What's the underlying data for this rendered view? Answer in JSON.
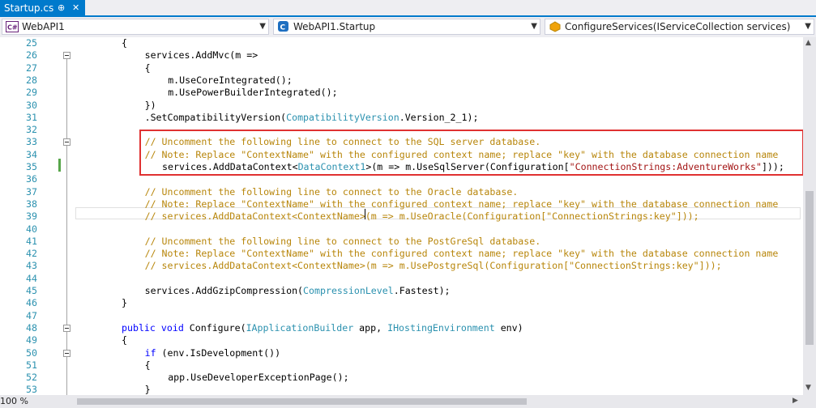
{
  "tab": {
    "title": "Startup.cs",
    "pin": "⊕",
    "close": "✕"
  },
  "nav": {
    "project": "WebAPI1",
    "type": "WebAPI1.Startup",
    "member": "ConfigureServices(IServiceCollection services)"
  },
  "editor": {
    "lines": [
      {
        "n": "25",
        "indent": 8,
        "tokens": [
          {
            "c": "p",
            "v": "{"
          }
        ]
      },
      {
        "n": "26",
        "indent": 12,
        "tokens": [
          {
            "c": "p",
            "v": "services.AddMvc(m =>"
          }
        ]
      },
      {
        "n": "27",
        "indent": 12,
        "tokens": [
          {
            "c": "p",
            "v": "{"
          }
        ]
      },
      {
        "n": "28",
        "indent": 16,
        "tokens": [
          {
            "c": "p",
            "v": "m.UseCoreIntegrated();"
          }
        ]
      },
      {
        "n": "29",
        "indent": 16,
        "tokens": [
          {
            "c": "p",
            "v": "m.UsePowerBuilderIntegrated();"
          }
        ]
      },
      {
        "n": "30",
        "indent": 12,
        "tokens": [
          {
            "c": "p",
            "v": "})"
          }
        ]
      },
      {
        "n": "31",
        "indent": 12,
        "tokens": [
          {
            "c": "p",
            "v": ".SetCompatibilityVersion("
          },
          {
            "c": "t",
            "v": "CompatibilityVersion"
          },
          {
            "c": "p",
            "v": ".Version_2_1);"
          }
        ]
      },
      {
        "n": "32",
        "indent": 0,
        "tokens": []
      },
      {
        "n": "33",
        "indent": 12,
        "tokens": [
          {
            "c": "cmt",
            "v": "// Uncomment the following line to connect to the SQL server database."
          }
        ]
      },
      {
        "n": "34",
        "indent": 12,
        "tokens": [
          {
            "c": "cmt",
            "v": "// Note: Replace \"ContextName\" with the configured context name; replace \"key\" with the database connection name"
          }
        ]
      },
      {
        "n": "35",
        "indent": 15,
        "tokens": [
          {
            "c": "p",
            "v": "services.AddDataContext<"
          },
          {
            "c": "t",
            "v": "DataContext1"
          },
          {
            "c": "p",
            "v": ">(m => m.UseSqlServer(Configuration["
          },
          {
            "c": "s",
            "v": "\"ConnectionStrings:AdventureWorks\""
          },
          {
            "c": "p",
            "v": "]));"
          }
        ]
      },
      {
        "n": "36",
        "indent": 0,
        "tokens": []
      },
      {
        "n": "37",
        "indent": 12,
        "tokens": [
          {
            "c": "cmt",
            "v": "// Uncomment the following line to connect to the Oracle database."
          }
        ]
      },
      {
        "n": "38",
        "indent": 12,
        "tokens": [
          {
            "c": "cmt",
            "v": "// Note: Replace \"ContextName\" with the configured context name; replace \"key\" with the database connection name"
          }
        ]
      },
      {
        "n": "39",
        "indent": 12,
        "tokens": [
          {
            "c": "cmt",
            "v": "// services.AddDataContext<ContextName>(m => m.UseOracle(Configuration[\"ConnectionStrings:key\"]));"
          }
        ]
      },
      {
        "n": "40",
        "indent": 0,
        "tokens": []
      },
      {
        "n": "41",
        "indent": 12,
        "tokens": [
          {
            "c": "cmt",
            "v": "// Uncomment the following line to connect to the PostGreSql database."
          }
        ]
      },
      {
        "n": "42",
        "indent": 12,
        "tokens": [
          {
            "c": "cmt",
            "v": "// Note: Replace \"ContextName\" with the configured context name; replace \"key\" with the database connection name"
          }
        ]
      },
      {
        "n": "43",
        "indent": 12,
        "tokens": [
          {
            "c": "cmt",
            "v": "// services.AddDataContext<ContextName>(m => m.UsePostgreSql(Configuration[\"ConnectionStrings:key\"]));"
          }
        ]
      },
      {
        "n": "44",
        "indent": 0,
        "tokens": []
      },
      {
        "n": "45",
        "indent": 12,
        "tokens": [
          {
            "c": "p",
            "v": "services.AddGzipCompression("
          },
          {
            "c": "t",
            "v": "CompressionLevel"
          },
          {
            "c": "p",
            "v": ".Fastest);"
          }
        ]
      },
      {
        "n": "46",
        "indent": 8,
        "tokens": [
          {
            "c": "p",
            "v": "}"
          }
        ]
      },
      {
        "n": "47",
        "indent": 0,
        "tokens": []
      },
      {
        "n": "48",
        "indent": 8,
        "tokens": [
          {
            "c": "k",
            "v": "public"
          },
          {
            "c": "p",
            "v": " "
          },
          {
            "c": "k",
            "v": "void"
          },
          {
            "c": "p",
            "v": " Configure("
          },
          {
            "c": "t",
            "v": "IApplicationBuilder"
          },
          {
            "c": "p",
            "v": " app, "
          },
          {
            "c": "t",
            "v": "IHostingEnvironment"
          },
          {
            "c": "p",
            "v": " env)"
          }
        ]
      },
      {
        "n": "49",
        "indent": 8,
        "tokens": [
          {
            "c": "p",
            "v": "{"
          }
        ]
      },
      {
        "n": "50",
        "indent": 12,
        "tokens": [
          {
            "c": "k",
            "v": "if"
          },
          {
            "c": "p",
            "v": " (env.IsDevelopment())"
          }
        ]
      },
      {
        "n": "51",
        "indent": 12,
        "tokens": [
          {
            "c": "p",
            "v": "{"
          }
        ]
      },
      {
        "n": "52",
        "indent": 16,
        "tokens": [
          {
            "c": "p",
            "v": "app.UseDeveloperExceptionPage();"
          }
        ]
      },
      {
        "n": "53",
        "indent": 12,
        "tokens": [
          {
            "c": "p",
            "v": "}"
          }
        ]
      }
    ],
    "fold_lines": [
      "26",
      "33",
      "48",
      "50"
    ]
  },
  "status": {
    "zoom": "100 %"
  }
}
